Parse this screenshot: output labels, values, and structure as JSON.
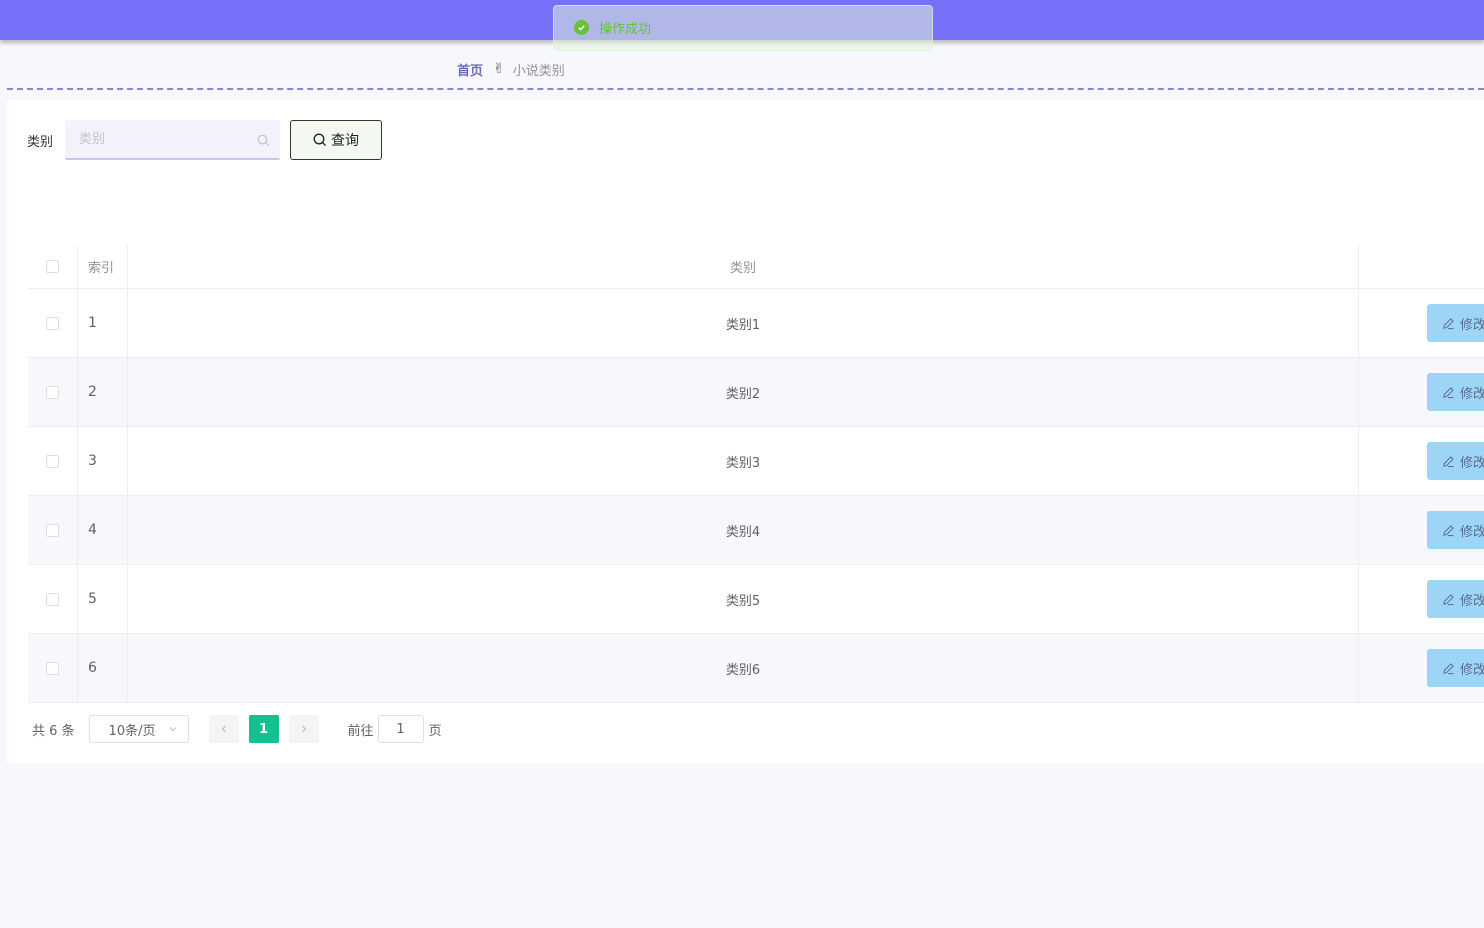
{
  "toast": {
    "message": "操作成功"
  },
  "breadcrumb": {
    "home": "首页",
    "separator": "✌",
    "current": "小说类别"
  },
  "search": {
    "label": "类别",
    "placeholder": "类别",
    "button_label": "查询"
  },
  "table": {
    "columns": {
      "index": "索引",
      "category": "类别"
    },
    "rows": [
      {
        "index": "1",
        "category": "类别1",
        "action": "修改"
      },
      {
        "index": "2",
        "category": "类别2",
        "action": "修改"
      },
      {
        "index": "3",
        "category": "类别3",
        "action": "修改"
      },
      {
        "index": "4",
        "category": "类别4",
        "action": "修改"
      },
      {
        "index": "5",
        "category": "类别5",
        "action": "修改"
      },
      {
        "index": "6",
        "category": "类别6",
        "action": "修改"
      }
    ]
  },
  "pagination": {
    "total": "共 6 条",
    "page_size": "10条/页",
    "current_page": "1",
    "goto_label": "前往",
    "goto_value": "1",
    "page_suffix": "页"
  },
  "colors": {
    "header": "#7571f9",
    "accent": "#13c091",
    "edit_button": "#9dd5f7",
    "success": "#67c23a"
  }
}
